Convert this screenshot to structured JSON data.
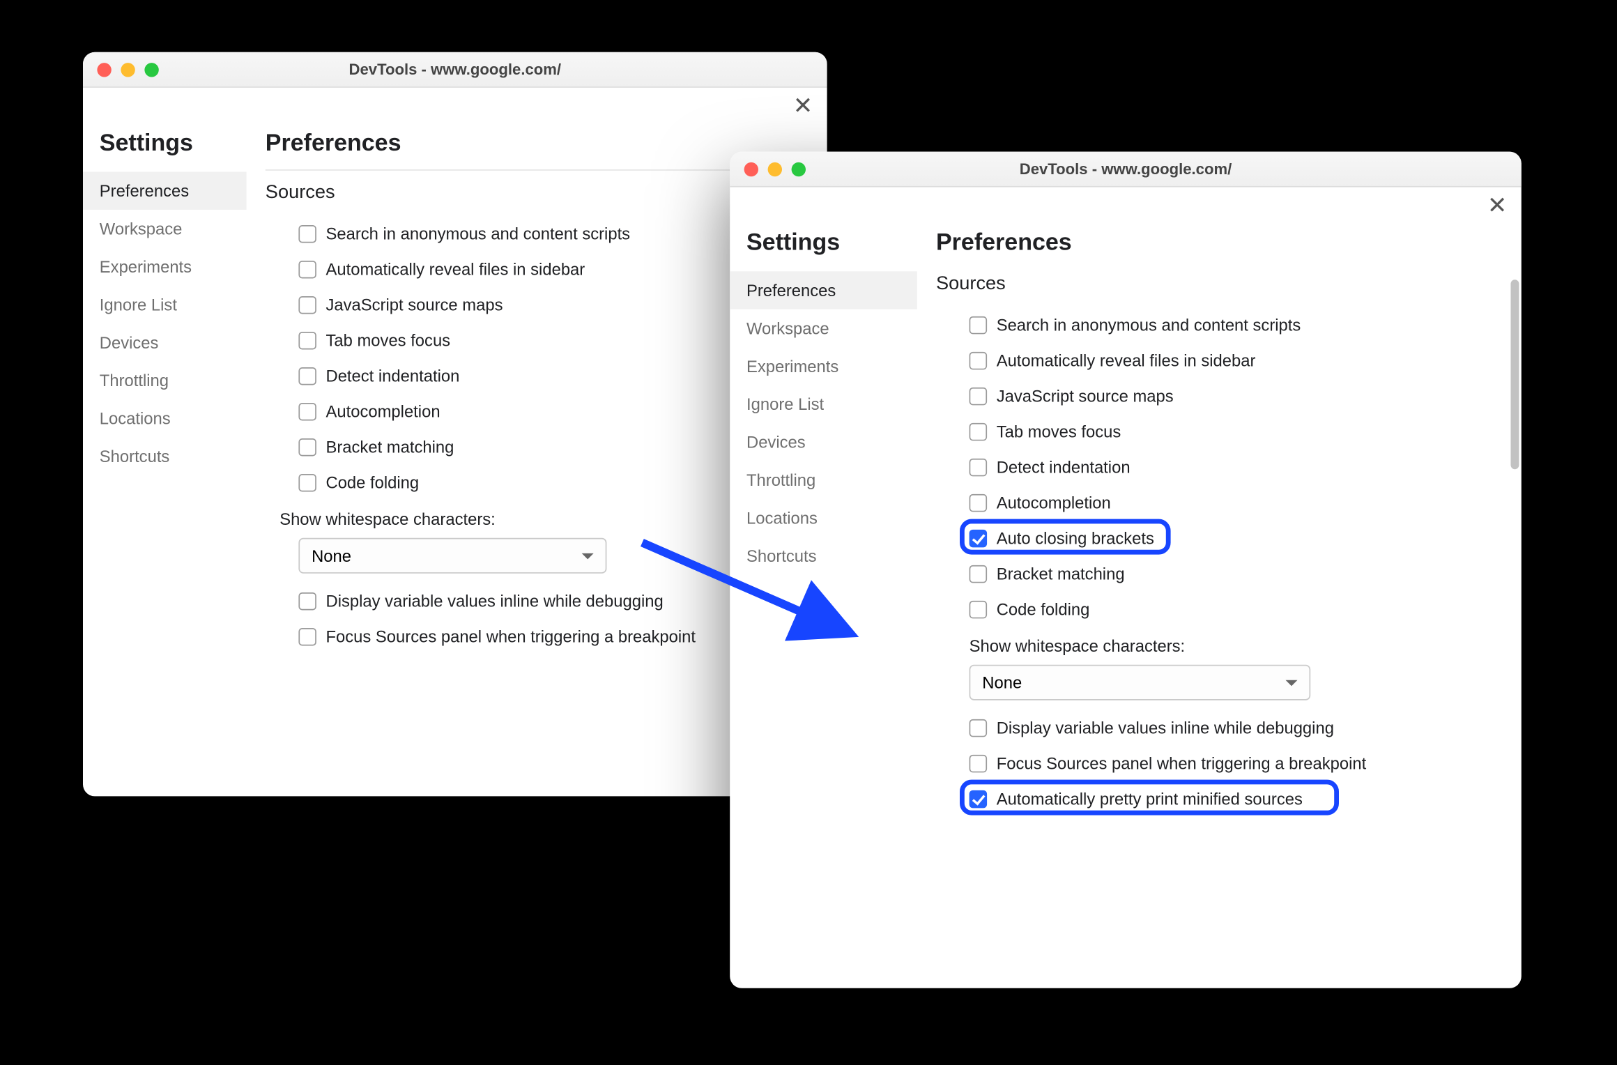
{
  "colors": {
    "accent": "#1745ff",
    "checkbox_checked": "#2563ff"
  },
  "left": {
    "window_title": "DevTools - www.google.com/",
    "sidebar_title": "Settings",
    "sidebar_items": [
      "Preferences",
      "Workspace",
      "Experiments",
      "Ignore List",
      "Devices",
      "Throttling",
      "Locations",
      "Shortcuts"
    ],
    "main_title": "Preferences",
    "section_title": "Sources",
    "options": [
      {
        "label": "Search in anonymous and content scripts",
        "checked": false
      },
      {
        "label": "Automatically reveal files in sidebar",
        "checked": false
      },
      {
        "label": "JavaScript source maps",
        "checked": false
      },
      {
        "label": "Tab moves focus",
        "checked": false
      },
      {
        "label": "Detect indentation",
        "checked": false
      },
      {
        "label": "Autocompletion",
        "checked": false
      },
      {
        "label": "Bracket matching",
        "checked": false
      },
      {
        "label": "Code folding",
        "checked": false
      }
    ],
    "select_label": "Show whitespace characters:",
    "select_value": "None",
    "tail": [
      {
        "label": "Display variable values inline while debugging",
        "checked": false
      },
      {
        "label": "Focus Sources panel when triggering a breakpoint",
        "checked": false
      }
    ]
  },
  "right": {
    "window_title": "DevTools - www.google.com/",
    "sidebar_title": "Settings",
    "sidebar_items": [
      "Preferences",
      "Workspace",
      "Experiments",
      "Ignore List",
      "Devices",
      "Throttling",
      "Locations",
      "Shortcuts"
    ],
    "main_title": "Preferences",
    "section_title": "Sources",
    "options": [
      {
        "label": "Search in anonymous and content scripts",
        "checked": false,
        "hl": false
      },
      {
        "label": "Automatically reveal files in sidebar",
        "checked": false,
        "hl": false
      },
      {
        "label": "JavaScript source maps",
        "checked": false,
        "hl": false
      },
      {
        "label": "Tab moves focus",
        "checked": false,
        "hl": false
      },
      {
        "label": "Detect indentation",
        "checked": false,
        "hl": false
      },
      {
        "label": "Autocompletion",
        "checked": false,
        "hl": false
      },
      {
        "label": "Auto closing brackets",
        "checked": true,
        "hl": true
      },
      {
        "label": "Bracket matching",
        "checked": false,
        "hl": false
      },
      {
        "label": "Code folding",
        "checked": false,
        "hl": false
      }
    ],
    "select_label": "Show whitespace characters:",
    "select_value": "None",
    "tail": [
      {
        "label": "Display variable values inline while debugging",
        "checked": false,
        "hl": false
      },
      {
        "label": "Focus Sources panel when triggering a breakpoint",
        "checked": false,
        "hl": false
      },
      {
        "label": "Automatically pretty print minified sources",
        "checked": true,
        "hl": true
      }
    ]
  }
}
